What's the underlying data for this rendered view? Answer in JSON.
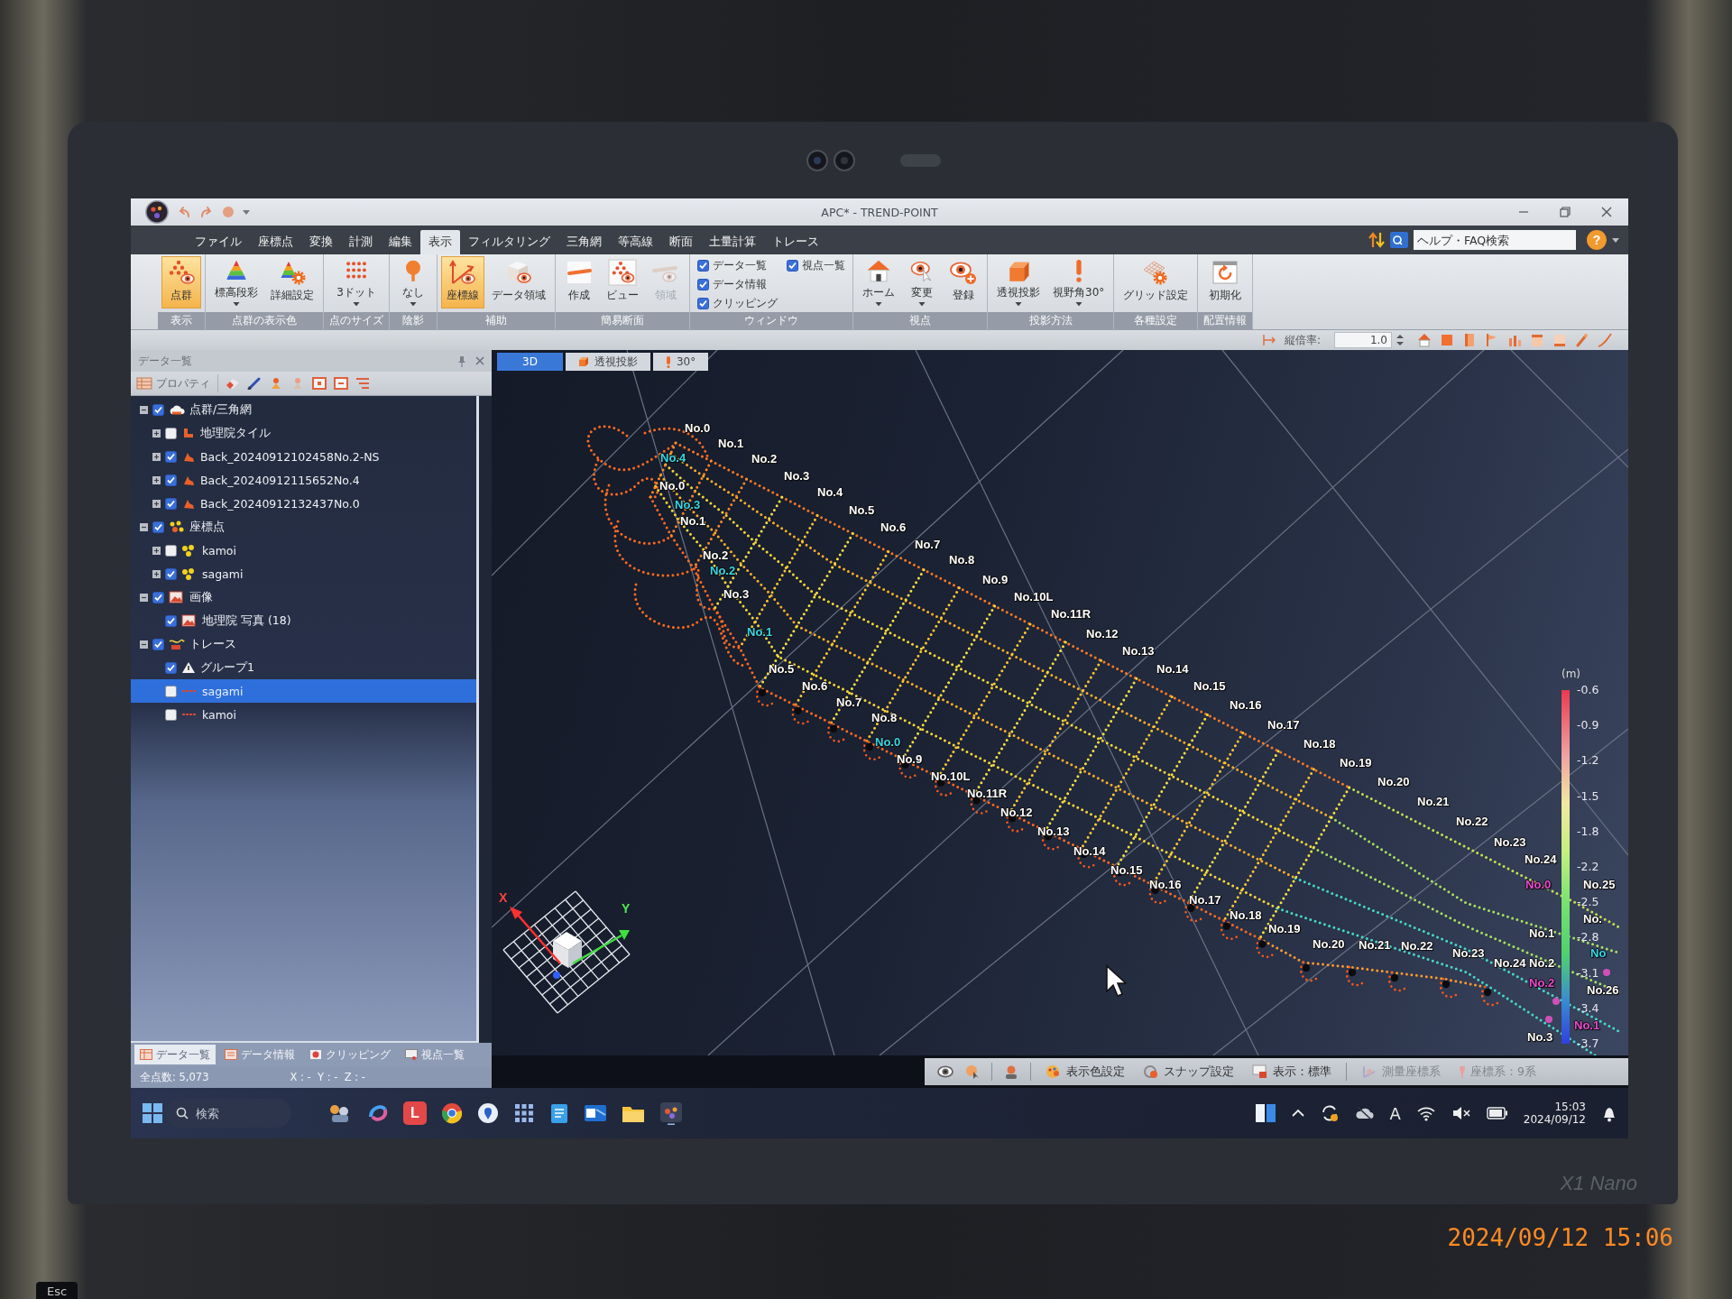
{
  "window": {
    "title": "APC* - TREND-POINT"
  },
  "help": {
    "search_placeholder": "ヘルプ・FAQ検索",
    "button": "?"
  },
  "menu_tabs": [
    {
      "label": "ファイル",
      "selected": false
    },
    {
      "label": "座標点",
      "selected": false
    },
    {
      "label": "変換",
      "selected": false
    },
    {
      "label": "計測",
      "selected": false
    },
    {
      "label": "編集",
      "selected": false
    },
    {
      "label": "表示",
      "selected": true
    },
    {
      "label": "フィルタリング",
      "selected": false
    },
    {
      "label": "三角網",
      "selected": false
    },
    {
      "label": "等高線",
      "selected": false
    },
    {
      "label": "断面",
      "selected": false
    },
    {
      "label": "土量計算",
      "selected": false
    },
    {
      "label": "トレース",
      "selected": false
    }
  ],
  "ribbon": {
    "groups": [
      {
        "label": "表示",
        "items": [
          {
            "kind": "button",
            "label": "点群",
            "selected": true,
            "disabled": false,
            "dropdown": false
          }
        ]
      },
      {
        "label": "点群の表示色",
        "items": [
          {
            "kind": "button",
            "label": "標高段彩",
            "selected": false,
            "disabled": false,
            "dropdown": true
          },
          {
            "kind": "button",
            "label": "詳細設定",
            "selected": false,
            "disabled": false,
            "dropdown": false
          }
        ]
      },
      {
        "label": "点のサイズ",
        "items": [
          {
            "kind": "button",
            "label": "3ドット",
            "selected": false,
            "disabled": false,
            "dropdown": true
          }
        ]
      },
      {
        "label": "陰影",
        "items": [
          {
            "kind": "button",
            "label": "なし",
            "selected": false,
            "disabled": false,
            "dropdown": true
          }
        ]
      },
      {
        "label": "補助",
        "items": [
          {
            "kind": "button",
            "label": "座標線",
            "selected": true,
            "disabled": false,
            "dropdown": false
          },
          {
            "kind": "button",
            "label": "データ領域",
            "selected": false,
            "disabled": false,
            "dropdown": false
          }
        ]
      },
      {
        "label": "簡易断面",
        "items": [
          {
            "kind": "button",
            "label": "作成",
            "selected": false,
            "disabled": false,
            "dropdown": false
          },
          {
            "kind": "button",
            "label": "ビュー",
            "selected": false,
            "disabled": false,
            "dropdown": false
          },
          {
            "kind": "button",
            "label": "領域",
            "selected": false,
            "disabled": true,
            "dropdown": false
          }
        ]
      },
      {
        "label": "ウィンドウ",
        "items": [
          {
            "kind": "checkbox",
            "label": "データ一覧",
            "checked": true
          },
          {
            "kind": "checkbox",
            "label": "視点一覧",
            "checked": true
          },
          {
            "kind": "checkbox",
            "label": "データ情報",
            "checked": true
          },
          {
            "kind": "checkbox",
            "label": "クリッピング",
            "checked": true
          }
        ]
      },
      {
        "label": "視点",
        "items": [
          {
            "kind": "button",
            "label": "ホーム",
            "selected": false,
            "disabled": false,
            "dropdown": true
          },
          {
            "kind": "button",
            "label": "変更",
            "selected": false,
            "disabled": false,
            "dropdown": true
          },
          {
            "kind": "button",
            "label": "登録",
            "selected": false,
            "disabled": false,
            "dropdown": false
          }
        ]
      },
      {
        "label": "投影方法",
        "items": [
          {
            "kind": "button",
            "label": "透視投影",
            "selected": false,
            "disabled": false,
            "dropdown": true
          },
          {
            "kind": "button",
            "label": "視野角30°",
            "selected": false,
            "disabled": false,
            "dropdown": true
          }
        ]
      },
      {
        "label": "各種設定",
        "items": [
          {
            "kind": "button",
            "label": "グリッド設定",
            "selected": false,
            "disabled": false,
            "dropdown": false
          }
        ]
      },
      {
        "label": "配置情報",
        "items": [
          {
            "kind": "button",
            "label": "初期化",
            "selected": false,
            "disabled": false,
            "dropdown": false
          }
        ]
      }
    ]
  },
  "view_toolbar": {
    "label": "縦倍率:",
    "value": "1.0"
  },
  "data_panel": {
    "title": "データ一覧",
    "toolbar_button": "プロパティ",
    "tree": [
      {
        "kind": "cloud_group",
        "label": "点群/三角網",
        "checked": true,
        "expanded": true,
        "selected": false,
        "children": [
          {
            "kind": "tile",
            "label": "地理院タイル",
            "checked": false,
            "expanded": false,
            "selected": false
          },
          {
            "kind": "scan",
            "label": "Back_20240912102458No.2-NS",
            "checked": true,
            "expanded": false,
            "selected": false
          },
          {
            "kind": "scan",
            "label": "Back_20240912115652No.4",
            "checked": true,
            "expanded": false,
            "selected": false
          },
          {
            "kind": "scan",
            "label": "Back_20240912132437No.0",
            "checked": true,
            "expanded": false,
            "selected": false
          }
        ]
      },
      {
        "kind": "point_group",
        "label": "座標点",
        "checked": true,
        "expanded": true,
        "selected": false,
        "children": [
          {
            "kind": "points",
            "label": "kamoi",
            "checked": false,
            "expanded": false,
            "selected": false
          },
          {
            "kind": "points",
            "label": "sagami",
            "checked": true,
            "expanded": false,
            "selected": false
          }
        ]
      },
      {
        "kind": "image_group",
        "label": "画像",
        "checked": true,
        "expanded": true,
        "selected": false,
        "children": [
          {
            "kind": "image",
            "label": "地理院 写真 (18)",
            "checked": true,
            "selected": false
          }
        ]
      },
      {
        "kind": "trace_group",
        "label": "トレース",
        "checked": true,
        "expanded": true,
        "selected": false,
        "children": [
          {
            "kind": "group",
            "label": "グループ1",
            "checked": true,
            "selected": false
          },
          {
            "kind": "trace",
            "label": "sagami",
            "checked": false,
            "selected": true
          },
          {
            "kind": "trace",
            "label": "kamoi",
            "checked": false,
            "selected": false
          }
        ]
      }
    ],
    "tabs": [
      {
        "label": "データ一覧",
        "selected": true
      },
      {
        "label": "データ情報",
        "selected": false
      },
      {
        "label": "クリッピング",
        "selected": false
      },
      {
        "label": "視点一覧",
        "selected": false
      }
    ],
    "status": {
      "point_count": "全点数: 5,073",
      "coordinates": "X : -  Y : -  Z : -"
    }
  },
  "view": {
    "tabs": [
      {
        "label": "3D",
        "selected": true
      },
      {
        "label": "透視投影",
        "selected": false
      },
      {
        "label": "30°",
        "selected": false
      }
    ],
    "labels": [
      {
        "text": "No.0",
        "color": "#ffffff"
      },
      {
        "text": "No.1",
        "color": "#ffffff"
      },
      {
        "text": "No.4",
        "color": "#36d6e6"
      },
      {
        "text": "No.2",
        "color": "#ffffff"
      },
      {
        "text": "No.3",
        "color": "#ffffff"
      },
      {
        "text": "No.0",
        "color": "#ffffff"
      },
      {
        "text": "No.4",
        "color": "#ffffff"
      },
      {
        "text": "No.3",
        "color": "#36d6e6"
      },
      {
        "text": "No.5",
        "color": "#ffffff"
      },
      {
        "text": "No.1",
        "color": "#ffffff"
      },
      {
        "text": "No.6",
        "color": "#ffffff"
      },
      {
        "text": "No.7",
        "color": "#ffffff"
      },
      {
        "text": "No.2",
        "color": "#ffffff"
      },
      {
        "text": "No.8",
        "color": "#ffffff"
      },
      {
        "text": "No.2",
        "color": "#36d6e6"
      },
      {
        "text": "No.9",
        "color": "#ffffff"
      },
      {
        "text": "No.3",
        "color": "#ffffff"
      },
      {
        "text": "No.10L",
        "color": "#ffffff"
      },
      {
        "text": "No.11R",
        "color": "#ffffff"
      },
      {
        "text": "No.1",
        "color": "#36d6e6"
      },
      {
        "text": "No.12",
        "color": "#ffffff"
      },
      {
        "text": "No.13",
        "color": "#ffffff"
      },
      {
        "text": "No.5",
        "color": "#ffffff"
      },
      {
        "text": "No.14",
        "color": "#ffffff"
      },
      {
        "text": "No.6",
        "color": "#ffffff"
      },
      {
        "text": "No.15",
        "color": "#ffffff"
      },
      {
        "text": "No.7",
        "color": "#ffffff"
      },
      {
        "text": "No.16",
        "color": "#ffffff"
      },
      {
        "text": "No.8",
        "color": "#ffffff"
      },
      {
        "text": "No.17",
        "color": "#ffffff"
      },
      {
        "text": "No.0",
        "color": "#36d6e6"
      },
      {
        "text": "No.18",
        "color": "#ffffff"
      },
      {
        "text": "No.9",
        "color": "#ffffff"
      },
      {
        "text": "No.19",
        "color": "#ffffff"
      },
      {
        "text": "No.10L",
        "color": "#ffffff"
      },
      {
        "text": "No.20",
        "color": "#ffffff"
      },
      {
        "text": "No.11R",
        "color": "#ffffff"
      },
      {
        "text": "No.21",
        "color": "#ffffff"
      },
      {
        "text": "No.12",
        "color": "#ffffff"
      },
      {
        "text": "No.22",
        "color": "#ffffff"
      },
      {
        "text": "No.13",
        "color": "#ffffff"
      },
      {
        "text": "No.23",
        "color": "#ffffff"
      },
      {
        "text": "No.14",
        "color": "#ffffff"
      },
      {
        "text": "No.24",
        "color": "#ffffff"
      },
      {
        "text": "No.15",
        "color": "#ffffff"
      },
      {
        "text": "No.16",
        "color": "#ffffff"
      },
      {
        "text": "No.0",
        "color": "#e84ad0"
      },
      {
        "text": "No.25",
        "color": "#ffffff"
      },
      {
        "text": "No.17",
        "color": "#ffffff"
      },
      {
        "text": "No.18",
        "color": "#ffffff"
      },
      {
        "text": "No.",
        "color": "#ffffff"
      },
      {
        "text": "No.19",
        "color": "#ffffff"
      },
      {
        "text": "No.1",
        "color": "#ffffff"
      },
      {
        "text": "No.20",
        "color": "#ffffff"
      },
      {
        "text": "No.21",
        "color": "#ffffff"
      },
      {
        "text": "No.22",
        "color": "#ffffff"
      },
      {
        "text": "No.23",
        "color": "#ffffff"
      },
      {
        "text": "No",
        "color": "#36d6e6"
      },
      {
        "text": "No.24",
        "color": "#ffffff"
      },
      {
        "text": "No.2",
        "color": "#ffffff"
      },
      {
        "text": "No.2",
        "color": "#e84ad0"
      },
      {
        "text": "No.26",
        "color": "#ffffff"
      },
      {
        "text": "No.1",
        "color": "#e84ad0"
      },
      {
        "text": "No.3",
        "color": "#ffffff"
      }
    ],
    "color_scale": {
      "unit": "(m)",
      "ticks": [
        "-0.6",
        "-0.9",
        "-1.2",
        "-1.5",
        "-1.8",
        "-2.2",
        "-2.5",
        "-2.8",
        "-3.1",
        "-3.4",
        "-3.7"
      ]
    },
    "axis_labels": [
      "X",
      "Y"
    ]
  },
  "status_bar": [
    {
      "label": "表示色設定",
      "disabled": false
    },
    {
      "label": "スナップ設定",
      "disabled": false
    },
    {
      "label": "表示：標準",
      "disabled": false
    },
    {
      "label": "測量座標系",
      "disabled": true
    },
    {
      "label": "座標系：9系",
      "disabled": true
    }
  ],
  "taskbar": {
    "search_placeholder": "検索",
    "app_letter": "L",
    "input_indicator": "A",
    "time": "15:03",
    "date": "2024/09/12"
  },
  "device": {
    "bezel_label": "X1 Nano",
    "key_label": "Esc",
    "photo_timestamp": "2024/09/12 15:06"
  }
}
